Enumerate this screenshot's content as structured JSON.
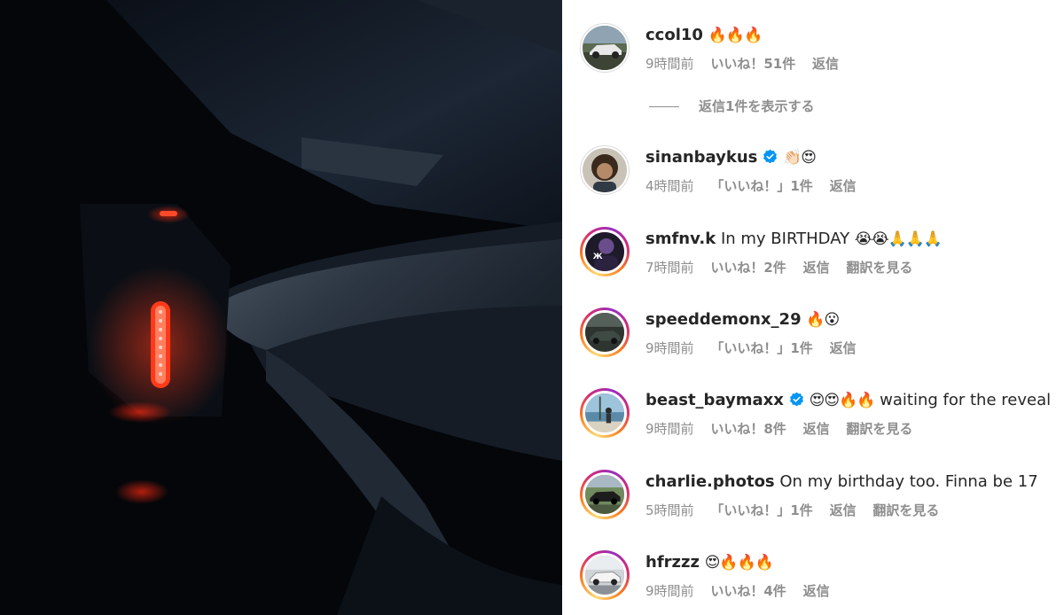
{
  "comments": [
    {
      "username": "ccol10",
      "verified": false,
      "text": "",
      "emoji": "🔥🔥🔥",
      "time": "9時間前",
      "likes": "いいね！51件",
      "reply": "返信",
      "translate": "",
      "avatar": "car-photo-avatar",
      "story_ring": false
    },
    {
      "username": "sinanbaykus",
      "verified": true,
      "text": "",
      "emoji": "👏🏻😍",
      "time": "4時間前",
      "likes": "「いいね！」1件",
      "reply": "返信",
      "translate": "",
      "avatar": "person-avatar",
      "story_ring": false
    },
    {
      "username": "smfnv.k",
      "verified": false,
      "text": "In my BIRTHDAY",
      "emoji": "😭😭🙏🙏🙏",
      "time": "7時間前",
      "likes": "いいね！2件",
      "reply": "返信",
      "translate": "翻訳を見る",
      "avatar": "person-avatar",
      "story_ring": true
    },
    {
      "username": "speeddemonx_29",
      "verified": false,
      "text": "",
      "emoji": "🔥😮",
      "time": "9時間前",
      "likes": "「いいね！」1件",
      "reply": "返信",
      "translate": "",
      "avatar": "car-photo-avatar",
      "story_ring": true
    },
    {
      "username": "beast_baymaxx",
      "verified": true,
      "text": "waiting for the reveal",
      "emoji": "😍😍🔥🔥",
      "time": "9時間前",
      "likes": "いいね！8件",
      "reply": "返信",
      "translate": "翻訳を見る",
      "avatar": "beach-person-avatar",
      "story_ring": true
    },
    {
      "username": "charlie.photos",
      "verified": false,
      "text": "On my birthday too. Finna be 17",
      "emoji": "",
      "time": "5時間前",
      "likes": "「いいね！」1件",
      "reply": "返信",
      "translate": "翻訳を見る",
      "avatar": "car-photo-avatar",
      "story_ring": true
    },
    {
      "username": "hfrzzz",
      "verified": false,
      "text": "",
      "emoji": "😍🔥🔥🔥",
      "time": "9時間前",
      "likes": "いいね！4件",
      "reply": "返信",
      "translate": "",
      "avatar": "car-photo-avatar",
      "story_ring": true
    }
  ],
  "view_replies": "返信1件を表示する",
  "colors": {
    "verified_badge": "#0095f6",
    "secondary_text": "#8e8e8e",
    "primary_text": "#262626",
    "tail_light": "#ff3a1a",
    "photo_background": "#05070c"
  }
}
